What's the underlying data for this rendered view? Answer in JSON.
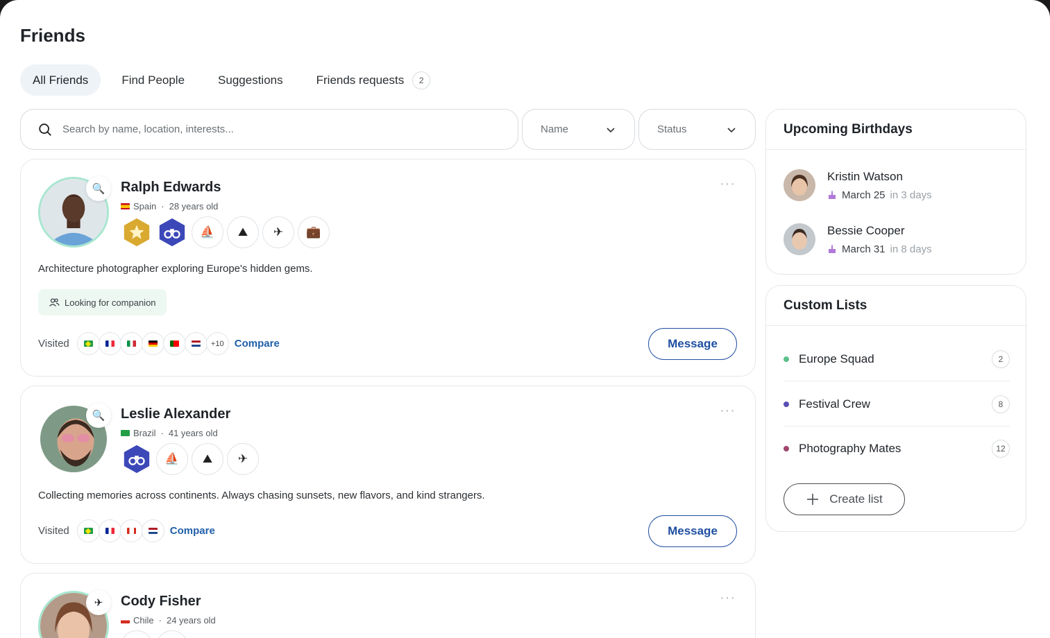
{
  "page": {
    "title": "Friends"
  },
  "tabs": [
    {
      "label": "All Friends",
      "active": true
    },
    {
      "label": "Find People"
    },
    {
      "label": "Suggestions"
    },
    {
      "label": "Friends requests",
      "count": "2"
    }
  ],
  "search": {
    "placeholder": "Search by name, location, interests...",
    "value": ""
  },
  "filters": {
    "name_label": "Name",
    "status_label": "Status"
  },
  "friends": [
    {
      "name": "Ralph Edwards",
      "country": "Spain",
      "age": "28 years old",
      "bio": "Architecture photographer exploring Europe's hidden gems.",
      "tag": "Looking for companion",
      "visited_label": "Visited",
      "visited_more": "+10",
      "compare": "Compare",
      "message": "Message",
      "more": "···"
    },
    {
      "name": "Leslie Alexander",
      "country": "Brazil",
      "age": "41 years old",
      "bio": "Collecting memories across continents. Always chasing sunsets, new flavors, and kind strangers.",
      "visited_label": "Visited",
      "compare": "Compare",
      "message": "Message",
      "more": "···"
    },
    {
      "name": "Cody Fisher",
      "country": "Chile",
      "age": "24 years old",
      "more": "···"
    }
  ],
  "birthdays": {
    "title": "Upcoming Birthdays",
    "items": [
      {
        "name": "Kristin Watson",
        "date": "March 25",
        "in": "in 3 days"
      },
      {
        "name": "Bessie Cooper",
        "date": "March 31",
        "in": "in 8 days"
      }
    ]
  },
  "custom_lists": {
    "title": "Custom Lists",
    "items": [
      {
        "name": "Europe Squad",
        "count": "2",
        "color": "#5cc08a"
      },
      {
        "name": "Festival Crew",
        "count": "8",
        "color": "#5a4fb5"
      },
      {
        "name": "Photography Mates",
        "count": "12",
        "color": "#a0466e"
      }
    ],
    "create_label": "Create list"
  },
  "colors": {
    "accent": "#1f4fa0",
    "ring": "#a8e6cf"
  }
}
